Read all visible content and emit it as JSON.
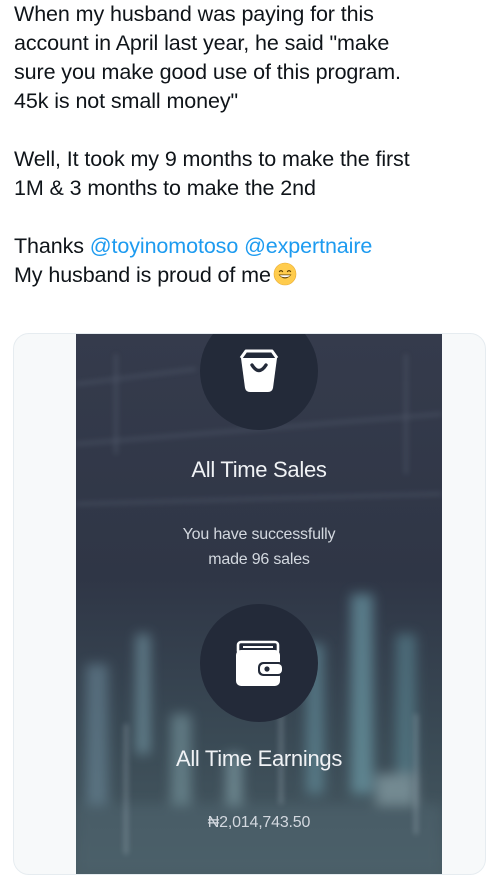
{
  "tweet": {
    "lines": [
      "When my husband was paying for this",
      "account in April last year, he said \"make",
      "sure you make good use of this program.",
      "45k is not small money\"",
      "Well, It took my 9 months to make the first",
      "1M & 3 months to make the 2nd",
      "Thanks",
      "My husband is proud of me"
    ],
    "mentions": [
      "@toyinomotoso",
      "@expertnaire"
    ],
    "emoji": "grinning-face-with-smiling-eyes"
  },
  "app": {
    "sales_icon": "shopping-bag-icon",
    "sales_heading": "All Time Sales",
    "sales_sub_line1": "You have successfully",
    "sales_sub_line2": "made 96 sales",
    "earnings_icon": "wallet-icon",
    "earnings_heading": "All Time Earnings",
    "earnings_value": "₦2,014,743.50"
  },
  "colors": {
    "mention": "#1d9bf0",
    "text": "#0f1419",
    "app_background": "#2d3446",
    "icon_circle": "#232a39"
  }
}
